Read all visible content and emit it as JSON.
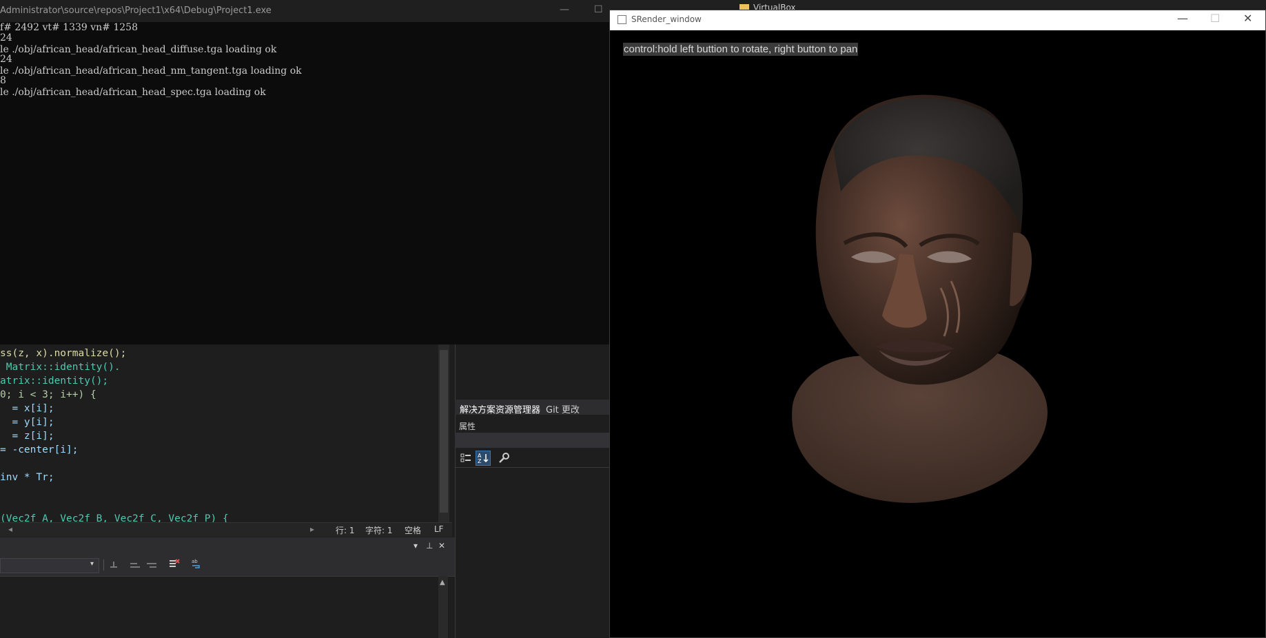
{
  "console": {
    "title": "Administrator\\source\\repos\\Project1\\x64\\Debug\\Project1.exe",
    "lines": [
      "f# 2492 vt# 1339 vn# 1258",
      "24",
      "le ./obj/african_head/african_head_diffuse.tga loading ok",
      "24",
      "le ./obj/african_head/african_head_nm_tangent.tga loading ok",
      "8",
      "le ./obj/african_head/african_head_spec.tga loading ok"
    ],
    "minimize": "—",
    "maximize": "☐"
  },
  "editor": {
    "lines": [
      "ss(z, x).normalize();",
      " Matrix::identity().",
      "atrix::identity();",
      "0; i < 3; i++) {",
      "  = x[i];",
      "  = y[i];",
      "  = z[i];",
      "= -center[i];",
      "",
      "inv * Tr;",
      "",
      "",
      "(Vec2f A, Vec2f B, Vec2f C, Vec2f P) {"
    ],
    "status": {
      "line": "行: 1",
      "char": "字符: 1",
      "spaces": "空格",
      "eol": "LF"
    }
  },
  "output_panel": {
    "header_icons": [
      "▾",
      "⊥",
      "✕"
    ]
  },
  "right_panel": {
    "tabs": [
      "解决方案资源管理器",
      "Git 更改"
    ],
    "properties_label": "属性"
  },
  "background": {
    "folder_label": "VirtualBox"
  },
  "render_window": {
    "title": "SRender_window",
    "hint": "control:hold left buttion to rotate, right button to pan",
    "minimize": "—",
    "maximize": "☐",
    "close": "✕"
  },
  "colors": {
    "keyword_teal": "#4ec9b0",
    "function_yellow": "#dcdcaa",
    "variable_blue": "#9cdcfe",
    "numeric": "#b5cea8",
    "skin_base": "#3a2a22",
    "skin_highlight": "#7a5a4a"
  }
}
